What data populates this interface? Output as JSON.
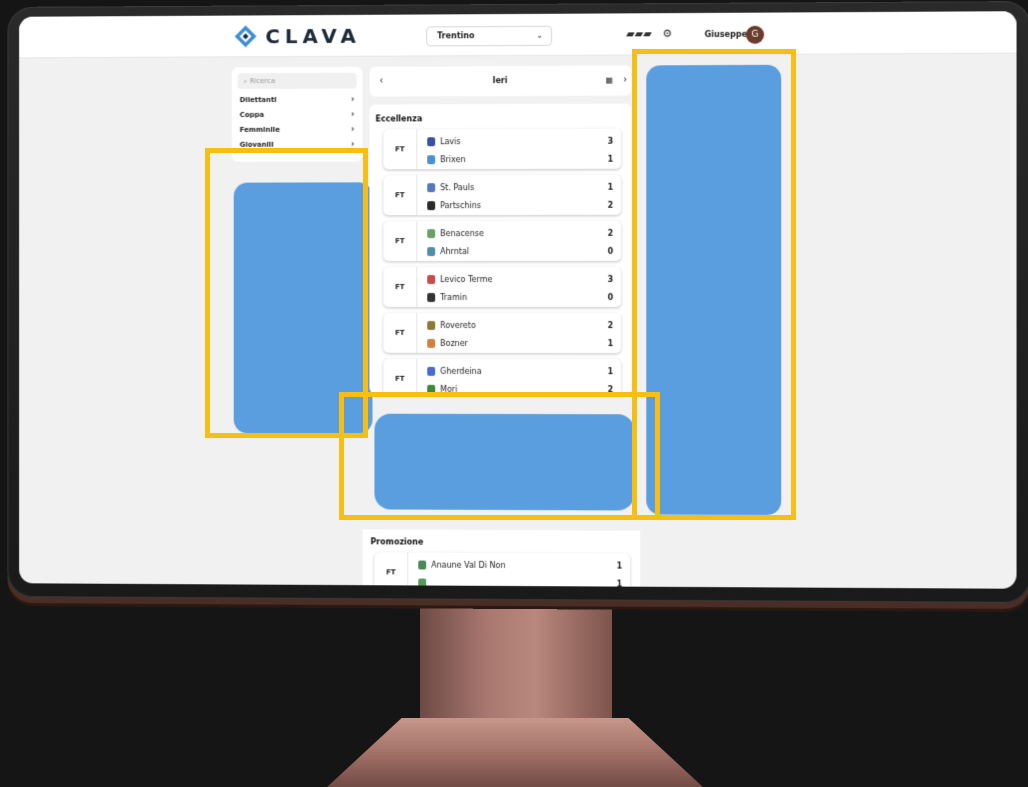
{
  "header": {
    "brand": "CLAVA",
    "region": "Trentino",
    "user_name": "Giuseppe",
    "user_initial": "G"
  },
  "sidebar": {
    "search_placeholder": "Ricerca",
    "items": [
      {
        "label": "Dilettanti"
      },
      {
        "label": "Coppa"
      },
      {
        "label": "Femminile"
      },
      {
        "label": "Giovanili"
      }
    ]
  },
  "date_nav": {
    "label": "Ieri"
  },
  "leagues": [
    {
      "title": "Eccellenza",
      "matches": [
        {
          "status": "FT",
          "home": "Lavis",
          "home_score": "3",
          "away": "Brixen",
          "away_score": "1",
          "home_color": "#3b4fa3",
          "away_color": "#4a90d9"
        },
        {
          "status": "FT",
          "home": "St. Pauls",
          "home_score": "1",
          "away": "Partschins",
          "away_score": "2",
          "home_color": "#5577bb",
          "away_color": "#2a2a2a"
        },
        {
          "status": "FT",
          "home": "Benacense",
          "home_score": "2",
          "away": "Ahrntal",
          "away_score": "0",
          "home_color": "#6aa06a",
          "away_color": "#4e8fa5"
        },
        {
          "status": "FT",
          "home": "Levico Terme",
          "home_score": "3",
          "away": "Tramin",
          "away_score": "0",
          "home_color": "#c94a4a",
          "away_color": "#333333"
        },
        {
          "status": "FT",
          "home": "Rovereto",
          "home_score": "2",
          "away": "Bozner",
          "away_score": "1",
          "home_color": "#8a7a3a",
          "away_color": "#d08040"
        },
        {
          "status": "FT",
          "home": "Gherdeina",
          "home_score": "1",
          "away": "Mori",
          "away_score": "2",
          "home_color": "#4a6ad0",
          "away_color": "#3a8a3a"
        }
      ]
    },
    {
      "title": "Promozione",
      "matches": [
        {
          "status": "FT",
          "home": "Anaune Val Di Non",
          "home_score": "1",
          "away": "",
          "away_score": "1",
          "home_color": "#4a8a5a",
          "away_color": "#5a9a5a"
        }
      ]
    }
  ],
  "colors": {
    "highlight": "#f5c013",
    "ad_placeholder": "#5a9ee0",
    "avatar": "#6a3b2c"
  }
}
